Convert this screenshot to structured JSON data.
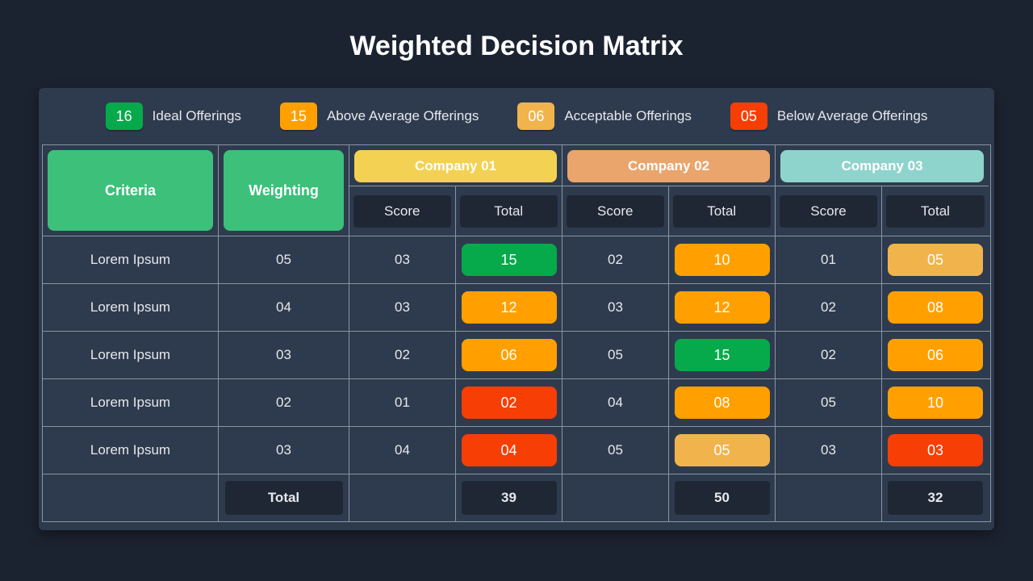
{
  "title": "Weighted Decision Matrix",
  "colors": {
    "ideal": "#06aa4b",
    "above": "#ffa000",
    "accept": "#f1b44c",
    "below": "#f73e05",
    "criteria_header": "#3cc07a",
    "company1": "#f3d153",
    "company2": "#e9a56c",
    "company3": "#8fd4cc"
  },
  "legend": [
    {
      "value": "16",
      "label": "Ideal Offerings",
      "colorKey": "ideal"
    },
    {
      "value": "15",
      "label": "Above Average Offerings",
      "colorKey": "above"
    },
    {
      "value": "06",
      "label": "Acceptable Offerings",
      "colorKey": "accept"
    },
    {
      "value": "05",
      "label": "Below Average Offerings",
      "colorKey": "below"
    }
  ],
  "headers": {
    "criteria": "Criteria",
    "weighting": "Weighting",
    "score": "Score",
    "totalCol": "Total",
    "totalRow": "Total"
  },
  "companies": [
    {
      "name": "Company 01",
      "colorKey": "company1"
    },
    {
      "name": "Company 02",
      "colorKey": "company2"
    },
    {
      "name": "Company 03",
      "colorKey": "company3"
    }
  ],
  "rows": [
    {
      "criteria": "Lorem Ipsum",
      "weight": "05",
      "c1_score": "03",
      "c1_total": {
        "v": "15",
        "c": "ideal"
      },
      "c2_score": "02",
      "c2_total": {
        "v": "10",
        "c": "above"
      },
      "c3_score": "01",
      "c3_total": {
        "v": "05",
        "c": "accept"
      }
    },
    {
      "criteria": "Lorem Ipsum",
      "weight": "04",
      "c1_score": "03",
      "c1_total": {
        "v": "12",
        "c": "above"
      },
      "c2_score": "03",
      "c2_total": {
        "v": "12",
        "c": "above"
      },
      "c3_score": "02",
      "c3_total": {
        "v": "08",
        "c": "above"
      }
    },
    {
      "criteria": "Lorem Ipsum",
      "weight": "03",
      "c1_score": "02",
      "c1_total": {
        "v": "06",
        "c": "above"
      },
      "c2_score": "05",
      "c2_total": {
        "v": "15",
        "c": "ideal"
      },
      "c3_score": "02",
      "c3_total": {
        "v": "06",
        "c": "above"
      }
    },
    {
      "criteria": "Lorem Ipsum",
      "weight": "02",
      "c1_score": "01",
      "c1_total": {
        "v": "02",
        "c": "below"
      },
      "c2_score": "04",
      "c2_total": {
        "v": "08",
        "c": "above"
      },
      "c3_score": "05",
      "c3_total": {
        "v": "10",
        "c": "above"
      }
    },
    {
      "criteria": "Lorem Ipsum",
      "weight": "03",
      "c1_score": "04",
      "c1_total": {
        "v": "04",
        "c": "below"
      },
      "c2_score": "05",
      "c2_total": {
        "v": "05",
        "c": "accept"
      },
      "c3_score": "03",
      "c3_total": {
        "v": "03",
        "c": "below"
      }
    }
  ],
  "totals": {
    "c1": "39",
    "c2": "50",
    "c3": "32"
  }
}
